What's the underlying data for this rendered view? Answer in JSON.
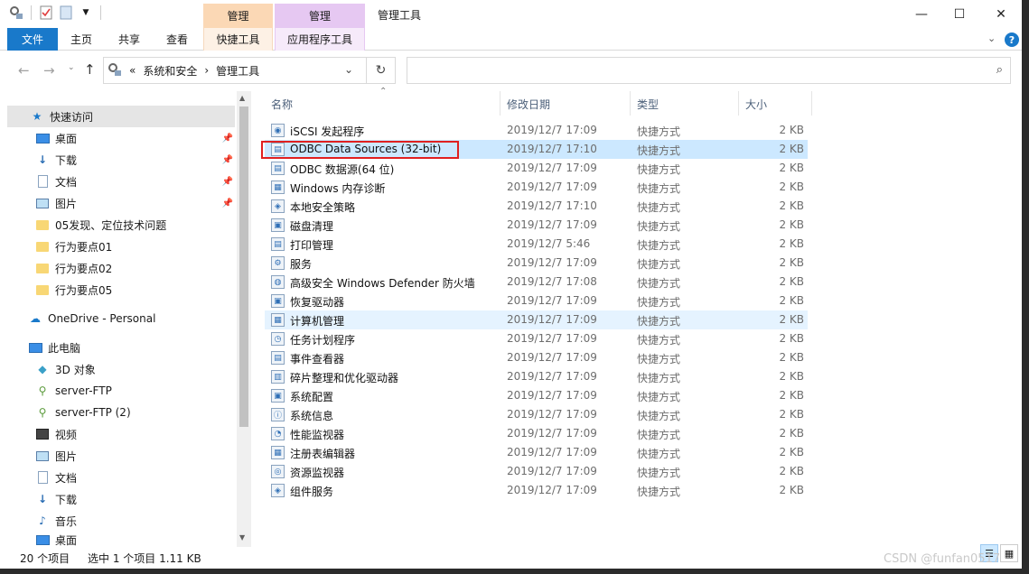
{
  "title_bar": {
    "context_tab_1": "管理",
    "context_tab_2": "管理",
    "window_title": "管理工具",
    "minimize": "—",
    "maximize": "☐",
    "close": "✕"
  },
  "ribbon": {
    "file": "文件",
    "home": "主页",
    "share": "共享",
    "view": "查看",
    "shortcut_tools": "快捷工具",
    "app_tools": "应用程序工具",
    "help": "?",
    "expand": "⌄"
  },
  "address": {
    "overflow": "«",
    "crumb_1": "系统和安全",
    "sep": "›",
    "crumb_2": "管理工具"
  },
  "columns": {
    "name": "名称",
    "date": "修改日期",
    "type": "类型",
    "size": "大小"
  },
  "nav": {
    "quick_access": "快速访问",
    "desktop": "桌面",
    "downloads": "下载",
    "documents": "文档",
    "pictures": "图片",
    "folder_1": "05发现、定位技术问题",
    "folder_2": "行为要点01",
    "folder_3": "行为要点02",
    "folder_4": "行为要点05",
    "onedrive": "OneDrive - Personal",
    "this_pc": "此电脑",
    "objects3d": "3D 对象",
    "server_ftp": "server-FTP",
    "server_ftp2": "server-FTP (2)",
    "videos": "视频",
    "pc_pictures": "图片",
    "pc_documents": "文档",
    "pc_downloads": "下载",
    "music": "音乐",
    "pc_desktop": "桌面"
  },
  "files": [
    {
      "name": "iSCSI 发起程序",
      "date": "2019/12/7 17:09",
      "type": "快捷方式",
      "size": "2 KB"
    },
    {
      "name": "ODBC Data Sources (32-bit)",
      "date": "2019/12/7 17:10",
      "type": "快捷方式",
      "size": "2 KB"
    },
    {
      "name": "ODBC 数据源(64 位)",
      "date": "2019/12/7 17:09",
      "type": "快捷方式",
      "size": "2 KB"
    },
    {
      "name": "Windows 内存诊断",
      "date": "2019/12/7 17:09",
      "type": "快捷方式",
      "size": "2 KB"
    },
    {
      "name": "本地安全策略",
      "date": "2019/12/7 17:10",
      "type": "快捷方式",
      "size": "2 KB"
    },
    {
      "name": "磁盘清理",
      "date": "2019/12/7 17:09",
      "type": "快捷方式",
      "size": "2 KB"
    },
    {
      "name": "打印管理",
      "date": "2019/12/7 5:46",
      "type": "快捷方式",
      "size": "2 KB"
    },
    {
      "name": "服务",
      "date": "2019/12/7 17:09",
      "type": "快捷方式",
      "size": "2 KB"
    },
    {
      "name": "高级安全 Windows Defender 防火墙",
      "date": "2019/12/7 17:08",
      "type": "快捷方式",
      "size": "2 KB"
    },
    {
      "name": "恢复驱动器",
      "date": "2019/12/7 17:09",
      "type": "快捷方式",
      "size": "2 KB"
    },
    {
      "name": "计算机管理",
      "date": "2019/12/7 17:09",
      "type": "快捷方式",
      "size": "2 KB"
    },
    {
      "name": "任务计划程序",
      "date": "2019/12/7 17:09",
      "type": "快捷方式",
      "size": "2 KB"
    },
    {
      "name": "事件查看器",
      "date": "2019/12/7 17:09",
      "type": "快捷方式",
      "size": "2 KB"
    },
    {
      "name": "碎片整理和优化驱动器",
      "date": "2019/12/7 17:09",
      "type": "快捷方式",
      "size": "2 KB"
    },
    {
      "name": "系统配置",
      "date": "2019/12/7 17:09",
      "type": "快捷方式",
      "size": "2 KB"
    },
    {
      "name": "系统信息",
      "date": "2019/12/7 17:09",
      "type": "快捷方式",
      "size": "2 KB"
    },
    {
      "name": "性能监视器",
      "date": "2019/12/7 17:09",
      "type": "快捷方式",
      "size": "2 KB"
    },
    {
      "name": "注册表编辑器",
      "date": "2019/12/7 17:09",
      "type": "快捷方式",
      "size": "2 KB"
    },
    {
      "name": "资源监视器",
      "date": "2019/12/7 17:09",
      "type": "快捷方式",
      "size": "2 KB"
    },
    {
      "name": "组件服务",
      "date": "2019/12/7 17:09",
      "type": "快捷方式",
      "size": "2 KB"
    }
  ],
  "status": {
    "count": "20 个项目",
    "selected": "选中 1 个项目  1.11 KB"
  },
  "watermark": "CSDN @funfan0517",
  "colors": {
    "accent": "#1979ca",
    "selection": "#cce8ff",
    "highlight_box": "#e02020"
  }
}
